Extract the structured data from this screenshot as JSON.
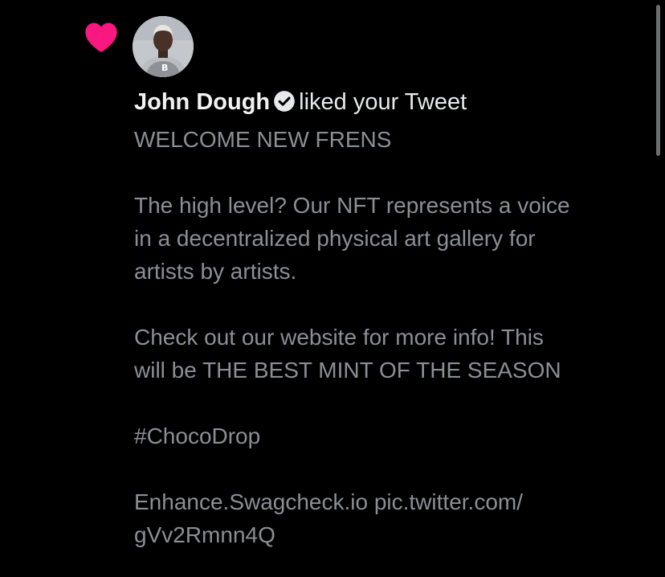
{
  "notification": {
    "icon": "heart-icon",
    "icon_color": "#f91880",
    "avatar": "user-avatar",
    "user_name": "John Dough",
    "verified_icon": "verified-badge-icon",
    "action": "liked your Tweet",
    "tweet": {
      "title": "WELCOME NEW FRENS",
      "paragraph1_line1": "The high level? Our NFT represents a voice",
      "paragraph1_line2": "in a decentralized physical art gallery for",
      "paragraph1_line3": "artists by artists.",
      "paragraph2_line1": "Check out our website for more info! This",
      "paragraph2_line2": "will be THE BEST MINT OF THE SEASON",
      "hashtag": "#ChocoDrop",
      "links_line1": "Enhance.Swagcheck.io pic.twitter.com/",
      "links_line2": "gVv2Rmnn4Q"
    }
  },
  "colors": {
    "background": "#000000",
    "primary_text": "#e7e9ea",
    "secondary_text": "#8b8f94",
    "like_pink": "#f91880"
  }
}
